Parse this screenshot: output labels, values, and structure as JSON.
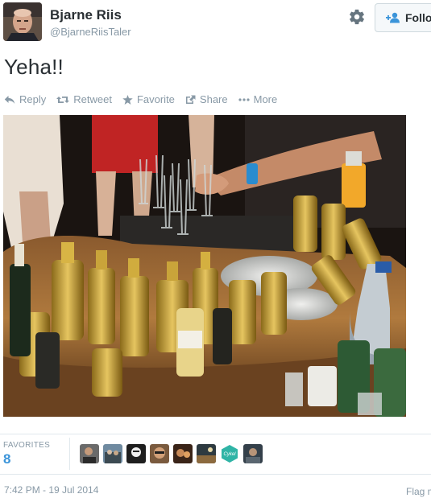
{
  "user": {
    "name": "Bjarne Riis",
    "handle": "@BjarneRiisTaler"
  },
  "header": {
    "follow_label": "Follo"
  },
  "tweet": {
    "text": "Yeha!!"
  },
  "actions": [
    {
      "label": "Reply",
      "icon": "reply-icon"
    },
    {
      "label": "Retweet",
      "icon": "retweet-icon"
    },
    {
      "label": "Favorite",
      "icon": "star-icon"
    },
    {
      "label": "Share",
      "icon": "share-icon"
    },
    {
      "label": "More",
      "icon": "more-dots-icon"
    }
  ],
  "stats": {
    "favorites_label": "FAVORITES",
    "favorites_count": "8"
  },
  "favoriter_avatars": [
    {
      "label": "Cykel"
    }
  ],
  "meta": {
    "timestamp": "7:42 PM - 19 Jul 2014",
    "flag_label": "Flag m"
  },
  "colors": {
    "link_blue": "#3b94d9",
    "muted": "#8899a6",
    "text": "#292f33",
    "divider": "#e1e8ed"
  }
}
